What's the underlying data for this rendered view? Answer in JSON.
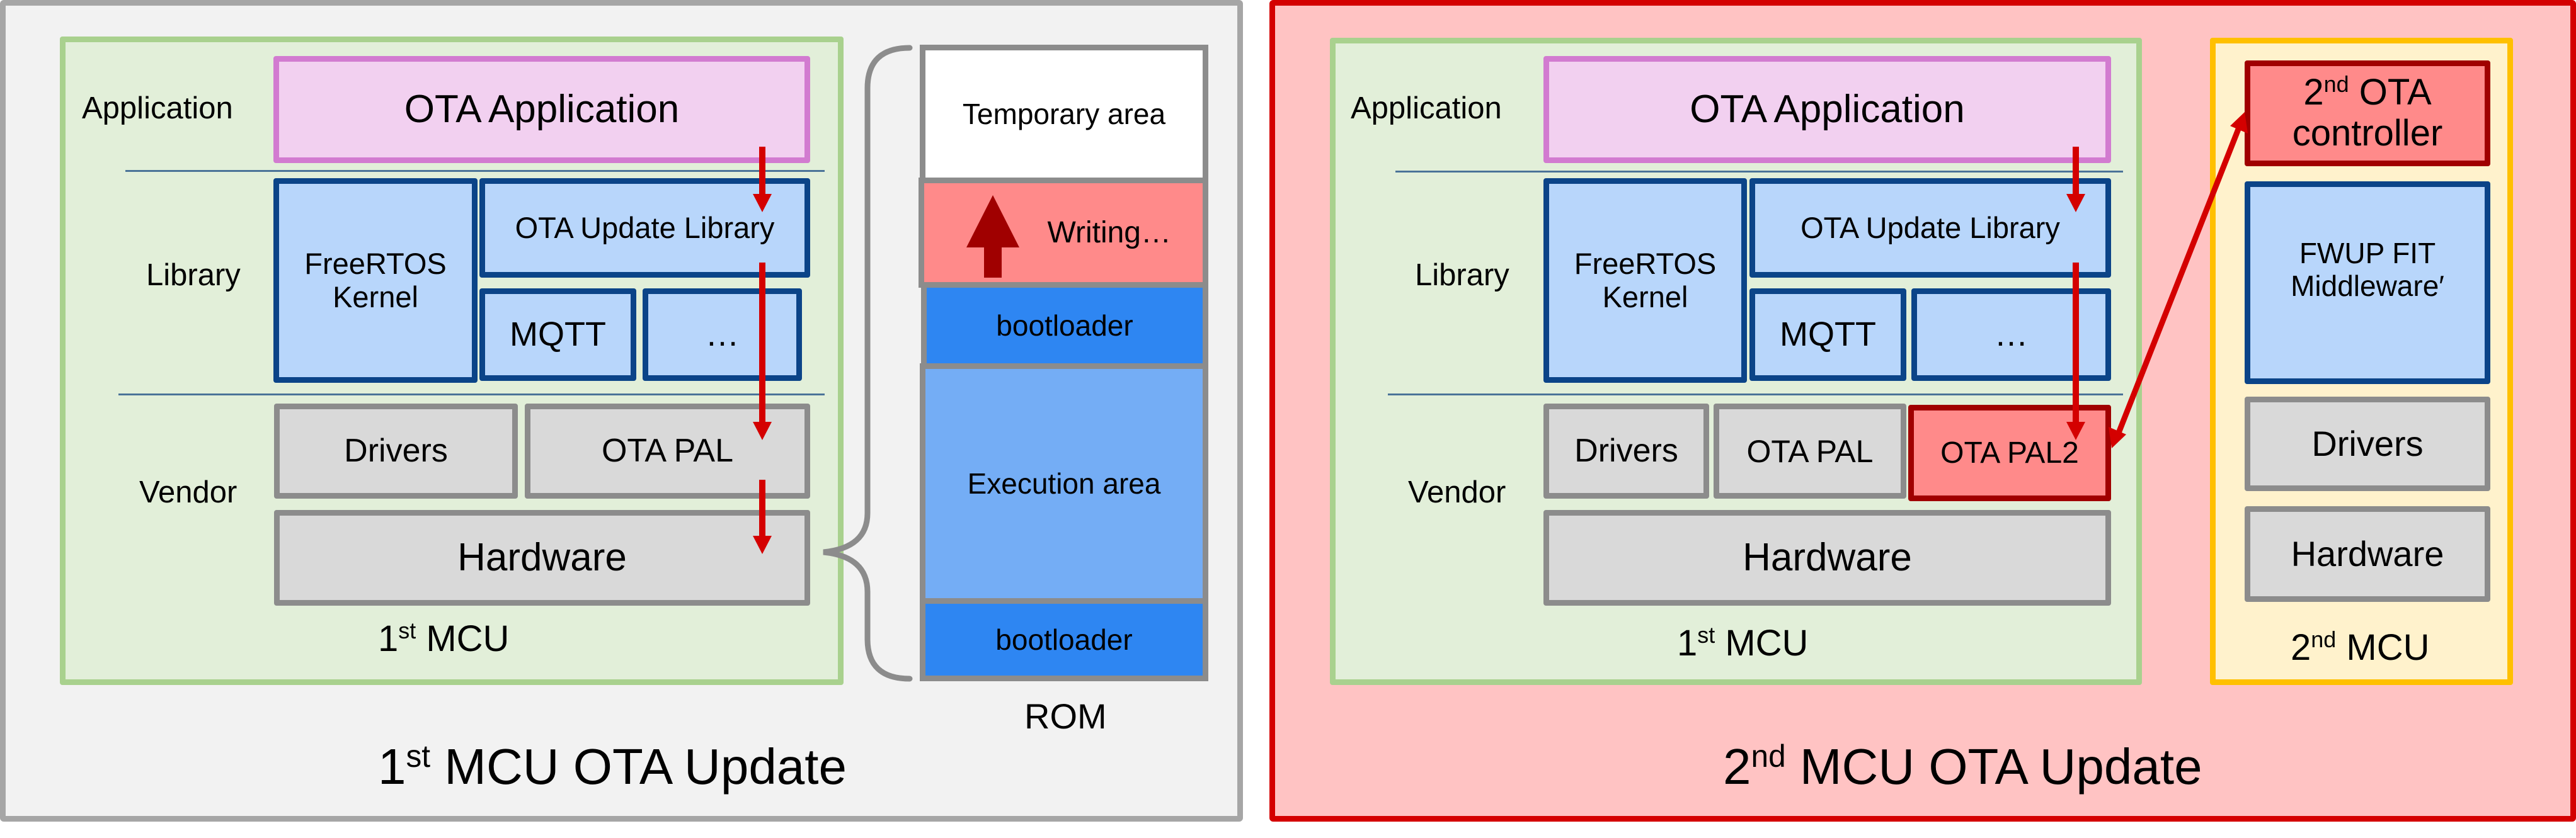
{
  "left_panel": {
    "title": {
      "ordinal": "1",
      "suffix": "st",
      "rest": " MCU OTA Update"
    },
    "mcu": {
      "label": {
        "ordinal": "1",
        "suffix": "st",
        "rest": " MCU"
      },
      "layers": {
        "application": "Application",
        "library": "Library",
        "vendor": "Vendor"
      },
      "blocks": {
        "ota_application": "OTA Application",
        "freertos_kernel_line1": "FreeRTOS",
        "freertos_kernel_line2": "Kernel",
        "ota_update_library": "OTA Update Library",
        "mqtt": "MQTT",
        "more": "…",
        "drivers": "Drivers",
        "ota_pal": "OTA PAL",
        "hardware": "Hardware"
      }
    },
    "rom": {
      "label": "ROM",
      "regions": {
        "temporary": "Temporary area",
        "writing": "Writing…",
        "bootloader_top": "bootloader",
        "execution": "Execution area",
        "bootloader_bottom": "bootloader"
      }
    }
  },
  "right_panel": {
    "title": {
      "ordinal": "2",
      "suffix": "nd",
      "rest": " MCU OTA Update"
    },
    "mcu1": {
      "label": {
        "ordinal": "1",
        "suffix": "st",
        "rest": " MCU"
      },
      "layers": {
        "application": "Application",
        "library": "Library",
        "vendor": "Vendor"
      },
      "blocks": {
        "ota_application": "OTA Application",
        "freertos_kernel_line1": "FreeRTOS",
        "freertos_kernel_line2": "Kernel",
        "ota_update_library": "OTA Update Library",
        "mqtt": "MQTT",
        "more": "…",
        "drivers": "Drivers",
        "ota_pal": "OTA PAL",
        "ota_pal2": "OTA PAL2",
        "hardware": "Hardware"
      }
    },
    "mcu2": {
      "label": {
        "ordinal": "2",
        "suffix": "nd",
        "rest": " MCU"
      },
      "blocks": {
        "controller": {
          "ordinal": "2",
          "suffix": "nd",
          "rest": " OTA",
          "line2": "controller"
        },
        "fwup_line1": "FWUP FIT",
        "fwup_line2": "Middleware′",
        "drivers": "Drivers",
        "hardware": "Hardware"
      }
    }
  },
  "colors": {
    "left_panel_bg": "#f2f2f2",
    "left_panel_border": "#a6a6a6",
    "right_panel_bg": "#ffc3c3",
    "right_panel_border": "#d40000",
    "arrow": "#d40000",
    "write_arrow": "#a00000"
  }
}
